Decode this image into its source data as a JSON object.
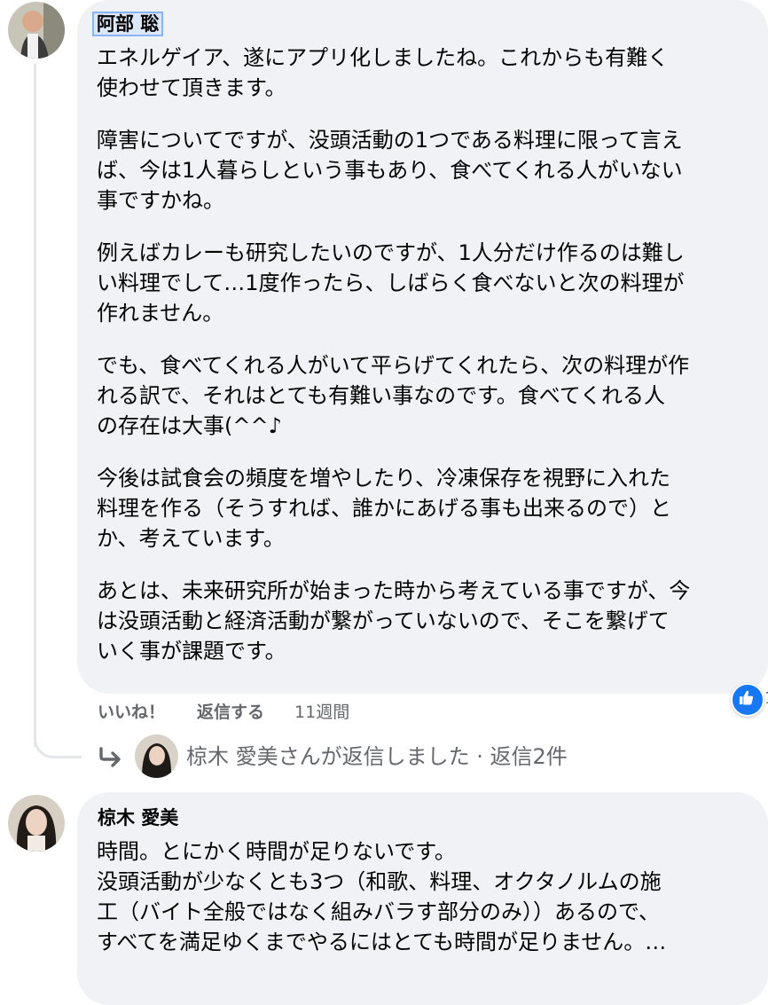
{
  "comment1": {
    "author": "阿部 聡",
    "paragraphs": [
      [
        "エネルゲイア、遂にアプリ化しましたね。これからも有難く",
        "使わせて頂きます。"
      ],
      [
        "障害についてですが、没頭活動の1つである料理に限って言え",
        "ば、今は1人暮らしという事もあり、食べてくれる人がいない",
        "事ですかね。"
      ],
      [
        "例えばカレーも研究したいのですが、1人分だけ作るのは難し",
        "い料理でして…1度作ったら、しばらく食べないと次の料理が",
        "作れません。"
      ],
      [
        "でも、食べてくれる人がいて平らげてくれたら、次の料理が作",
        "れる訳で、それはとても有難い事なのです。食べてくれる人",
        "の存在は大事(^^♪"
      ],
      [
        "今後は試食会の頻度を増やしたり、冷凍保存を視野に入れた",
        "料理を作る（そうすれば、誰かにあげる事も出来るので）と",
        "か、考えています。"
      ],
      [
        "あとは、未来研究所が始まった時から考えている事ですが、今",
        "は没頭活動と経済活動が繋がっていないので、そこを繋げて",
        "いく事が課題です。"
      ]
    ],
    "actions": {
      "like": "いいね！",
      "reply": "返信する",
      "time": "11週間"
    },
    "reaction_icon": "thumbs-up-icon",
    "reaction_count": "1"
  },
  "reply_summary": {
    "icon": "reply-arrow-icon",
    "text": "椋木 愛美さんが返信しました · 返信2件"
  },
  "comment2": {
    "author": "椋木 愛美",
    "lines": [
      "時間。とにかく時間が足りないです。",
      "没頭活動が少なくとも3つ（和歌、料理、オクタノルムの施",
      "工（バイト全般ではなく組みバラす部分のみ））あるので、",
      "すべてを満足ゆくまでやるにはとても時間が足りません。…"
    ]
  },
  "colors": {
    "bubble": "#f0f2f5",
    "secondary_text": "#65676b",
    "reaction_blue": "#1877f2"
  }
}
